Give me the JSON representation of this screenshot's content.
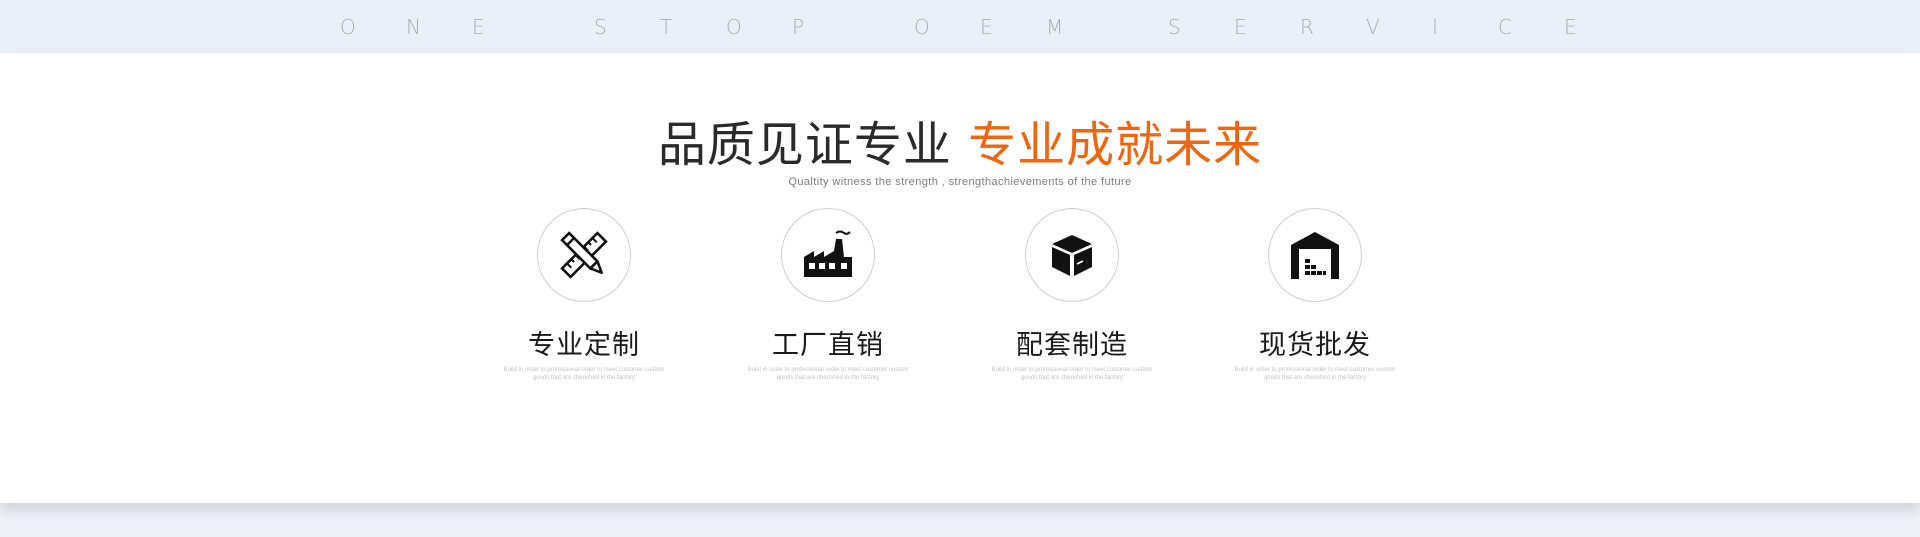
{
  "tagline": {
    "words": [
      [
        "O",
        "N",
        "E"
      ],
      [
        "S",
        "T",
        "O",
        "P"
      ],
      [
        "O",
        "E",
        "M"
      ],
      [
        "S",
        "E",
        "R",
        "V",
        "I",
        "C",
        "E"
      ]
    ]
  },
  "section": {
    "title_main": "品质见证专业",
    "title_accent": "专业成就未来",
    "subtitle": "Qualtity witness the strength , strengthachievements of the future",
    "accent_color": "#f0650f"
  },
  "features": [
    {
      "icon": "pencil-ruler-icon",
      "title": "专业定制",
      "desc": "Build in order to professional order to meet customer custom goods that are cherished in the factory"
    },
    {
      "icon": "factory-icon",
      "title": "工厂直销",
      "desc": "Build in order to professional order to meet customer custom goods that are cherished in the factory"
    },
    {
      "icon": "box-icon",
      "title": "配套制造",
      "desc": "Build in order to professional order to meet customer custom goods that are cherished in the factory"
    },
    {
      "icon": "warehouse-icon",
      "title": "现货批发",
      "desc": "Build in order to professional order to meet customer custom goods that are cherished in the factory"
    }
  ]
}
